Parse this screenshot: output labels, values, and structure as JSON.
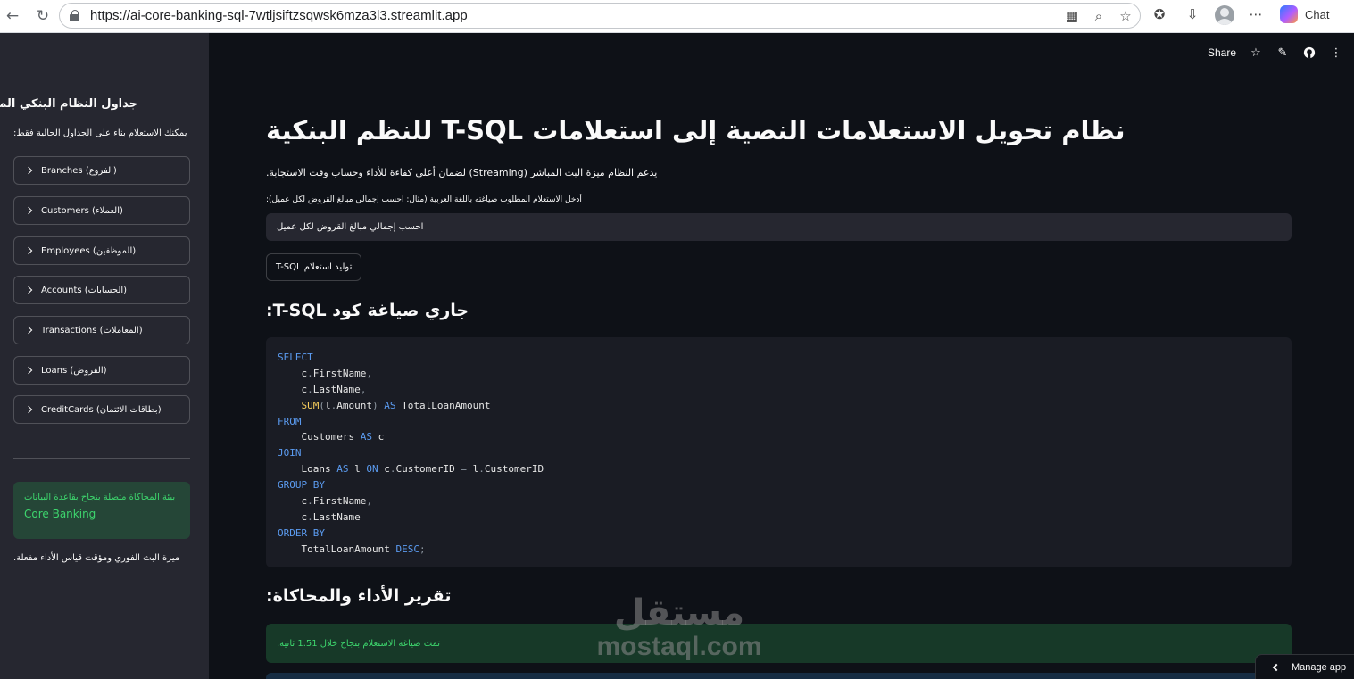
{
  "browser": {
    "url": "https://ai-core-banking-sql-7wtljsiftzsqwsk6mza3l3.streamlit.app",
    "chat_label": "Chat"
  },
  "sidebar": {
    "title": "جداول النظام البنكي المتاحة",
    "subtitle": "يمكنك الاستعلام بناء على الجداول الحالية فقط:",
    "tables": [
      {
        "label": "Branches (الفروع)"
      },
      {
        "label": "Customers (العملاء)"
      },
      {
        "label": "Employees (الموظفين)"
      },
      {
        "label": "Accounts (الحسابات)"
      },
      {
        "label": "Transactions (المعاملات)"
      },
      {
        "label": "Loans (القروض)"
      },
      {
        "label": "CreditCards (بطاقات الائتمان)"
      }
    ],
    "success_line1": "بيئة المحاكاة متصلة بنجاح بقاعدة البيانات",
    "success_line2": "Core Banking",
    "footer": "ميزة البث الفوري ومؤقت قياس الأداء مفعلة."
  },
  "header": {
    "share_label": "Share"
  },
  "main": {
    "title": "نظام تحويل الاستعلامات النصية إلى استعلامات T-SQL للنظم البنكية",
    "description": "يدعم النظام ميزة البث المباشر (Streaming) لضمان أعلى كفاءة للأداء وحساب وقت الاستجابة.",
    "input_label": "أدخل الاستعلام المطلوب صياغته باللغة العربية (مثال: احسب إجمالي مبالغ القروض لكل عميل):",
    "input_value": "احسب إجمالي مبالغ القروض لكل عميل",
    "generate_button": "توليد استعلام T-SQL",
    "code_heading": "جاري صياغة كود T-SQL:",
    "report_heading": "تقرير الأداء والمحاكاة:",
    "report_message": "تمت صياغة الاستعلام بنجاح خلال 1.51 ثانية."
  },
  "code_lines": [
    [
      [
        "kw",
        "SELECT"
      ]
    ],
    [
      [
        "tx",
        "    c"
      ],
      [
        "pn",
        "."
      ],
      [
        "tx",
        "FirstName"
      ],
      [
        "pn",
        ","
      ]
    ],
    [
      [
        "tx",
        "    c"
      ],
      [
        "pn",
        "."
      ],
      [
        "tx",
        "LastName"
      ],
      [
        "pn",
        ","
      ]
    ],
    [
      [
        "tx",
        "    "
      ],
      [
        "fn",
        "SUM"
      ],
      [
        "pn",
        "("
      ],
      [
        "tx",
        "l"
      ],
      [
        "pn",
        "."
      ],
      [
        "tx",
        "Amount"
      ],
      [
        "pn",
        ")"
      ],
      [
        "tx",
        " "
      ],
      [
        "kw",
        "AS"
      ],
      [
        "tx",
        " TotalLoanAmount"
      ]
    ],
    [
      [
        "kw",
        "FROM"
      ]
    ],
    [
      [
        "tx",
        "    Customers "
      ],
      [
        "kw",
        "AS"
      ],
      [
        "tx",
        " c"
      ]
    ],
    [
      [
        "kw",
        "JOIN"
      ]
    ],
    [
      [
        "tx",
        "    Loans "
      ],
      [
        "kw",
        "AS"
      ],
      [
        "tx",
        " l "
      ],
      [
        "kw",
        "ON"
      ],
      [
        "tx",
        " c"
      ],
      [
        "pn",
        "."
      ],
      [
        "tx",
        "CustomerID "
      ],
      [
        "pn",
        "="
      ],
      [
        "tx",
        " l"
      ],
      [
        "pn",
        "."
      ],
      [
        "tx",
        "CustomerID"
      ]
    ],
    [
      [
        "kw",
        "GROUP BY"
      ]
    ],
    [
      [
        "tx",
        "    c"
      ],
      [
        "pn",
        "."
      ],
      [
        "tx",
        "FirstName"
      ],
      [
        "pn",
        ","
      ]
    ],
    [
      [
        "tx",
        "    c"
      ],
      [
        "pn",
        "."
      ],
      [
        "tx",
        "LastName"
      ]
    ],
    [
      [
        "kw",
        "ORDER BY"
      ]
    ],
    [
      [
        "tx",
        "    TotalLoanAmount "
      ],
      [
        "kw",
        "DESC"
      ],
      [
        "pn",
        ";"
      ]
    ]
  ],
  "watermark": {
    "arabic": "مستقل",
    "latin": "mostaql.com"
  },
  "manage_app_label": "Manage app",
  "colors": {
    "background": "#0e1117",
    "sidebar": "#262730",
    "success": "#3dd56d",
    "keyword": "#5b9bf0"
  }
}
